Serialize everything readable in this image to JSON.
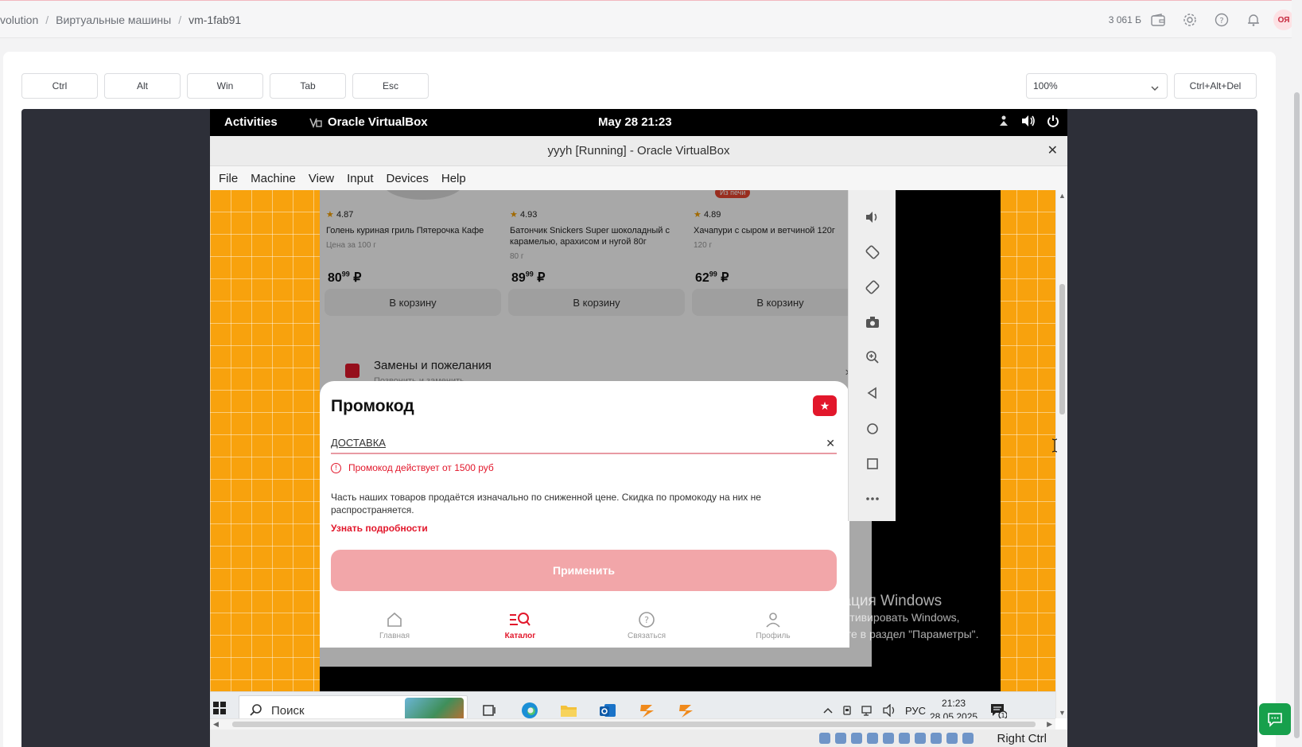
{
  "header": {
    "breadcrumbs": [
      "volution",
      "Виртуальные машины",
      "vm-1fab91"
    ],
    "balance": "3 061 Б",
    "avatar_initials": "ОЯ",
    "accent_color": "#c5283d"
  },
  "toolbar": {
    "keys": [
      "Ctrl",
      "Alt",
      "Win",
      "Tab",
      "Esc"
    ],
    "zoom_value": "100%",
    "ctrl_alt_del": "Ctrl+Alt+Del"
  },
  "guest": {
    "gnome": {
      "activities": "Activities",
      "app_name": "Oracle VirtualBox",
      "clock": "May 28  21:23"
    },
    "vbox": {
      "window_title": "yyyh [Running] - Oracle VirtualBox",
      "menu": [
        "File",
        "Machine",
        "View",
        "Input",
        "Devices",
        "Help"
      ],
      "host_key": "Right Ctrl"
    }
  },
  "shop": {
    "products": [
      {
        "rating": "4.87",
        "name": "Голень куриная гриль Пятерочка Кафе",
        "weight": "Цена за 100 г",
        "price_main": "80",
        "price_cents": "99",
        "currency": "₽",
        "add": "В корзину"
      },
      {
        "rating": "4.93",
        "name": "Батончик Snickers Super шоколадный с карамелью, арахисом и нугой 80г",
        "weight": "80 г",
        "price_main": "89",
        "price_cents": "99",
        "currency": "₽",
        "add": "В корзину"
      },
      {
        "rating": "4.89",
        "name": "Хачапури с сыром и ветчиной 120г",
        "weight": "120 г",
        "price_main": "62",
        "price_cents": "99",
        "currency": "₽",
        "add": "В корзину"
      }
    ],
    "badge": "Из печи",
    "replacements_title": "Замены и пожелания",
    "replacements_sub": "Позвонить и заменить",
    "promo": {
      "title": "Промокод",
      "code_value": "ДОСТАВКА",
      "error": "Промокод действует от 1500 руб",
      "info": "Часть наших товаров продаётся изначально по сниженной цене. Скидка по промокоду на них не распространяется.",
      "details_link": "Узнать подробности",
      "apply": "Применить"
    },
    "nav": [
      "Главная",
      "Каталог",
      "Связаться",
      "Профиль"
    ],
    "brand_color": "#e2172b"
  },
  "windows": {
    "search_placeholder": "Поиск",
    "lang": "РУС",
    "time": "21:23",
    "date": "28.05.2025",
    "activation_title": "Активация Windows",
    "activation_line1": "Чтобы активировать Windows,",
    "activation_line2": "перейдите в раздел \"Параметры\".",
    "notif_count": "1"
  }
}
